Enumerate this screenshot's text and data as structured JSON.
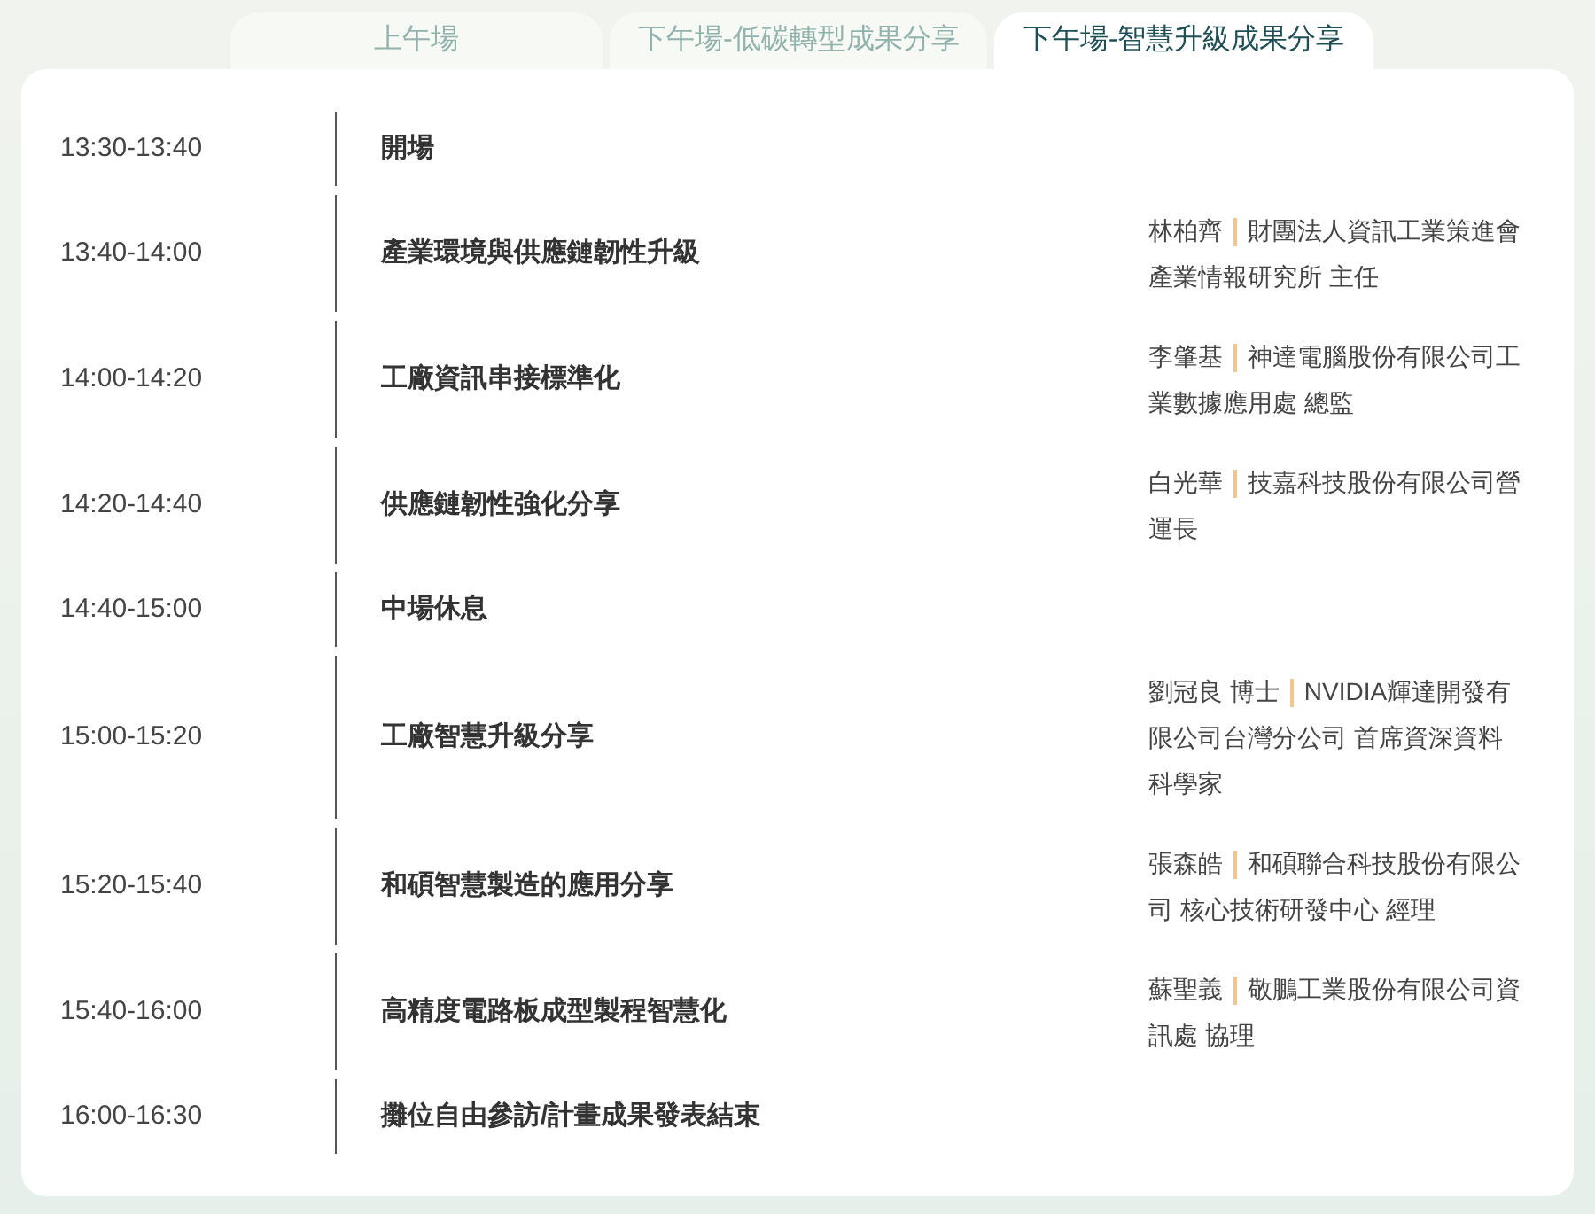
{
  "tabs": [
    {
      "label": "上午場",
      "selected": false
    },
    {
      "label": "下午場-低碳轉型成果分享",
      "selected": false
    },
    {
      "label": "下午場-智慧升級成果分享",
      "selected": true
    }
  ],
  "schedule": [
    {
      "time": "13:30-13:40",
      "title": "開場"
    },
    {
      "time": "13:40-14:00",
      "title": "產業環境與供應鏈韌性升級",
      "speaker": {
        "name": "林柏齊",
        "org": "財團法人資訊工業策進會產業情報研究所 主任"
      }
    },
    {
      "time": "14:00-14:20",
      "title": "工廠資訊串接標準化",
      "speaker": {
        "name": "李肇基",
        "org": "神達電腦股份有限公司工業數據應用處 總監"
      }
    },
    {
      "time": "14:20-14:40",
      "title": "供應鏈韌性強化分享",
      "speaker": {
        "name": "白光華",
        "org": "技嘉科技股份有限公司營運長"
      }
    },
    {
      "time": "14:40-15:00",
      "title": "中場休息"
    },
    {
      "time": "15:00-15:20",
      "title": "工廠智慧升級分享",
      "speaker": {
        "name": "劉冠良 博士",
        "org": "NVIDIA輝達開發有限公司台灣分公司 首席資深資料科學家"
      }
    },
    {
      "time": "15:20-15:40",
      "title": "和碩智慧製造的應用分享",
      "speaker": {
        "name": "張森皓",
        "org": "和碩聯合科技股份有限公司 核心技術研發中心 經理"
      }
    },
    {
      "time": "15:40-16:00",
      "title": "高精度電路板成型製程智慧化",
      "speaker": {
        "name": "蘇聖義",
        "org": "敬鵬工業股份有限公司資訊處 協理"
      }
    },
    {
      "time": "16:00-16:30",
      "title": "攤位自由參訪/計畫成果發表結束"
    }
  ]
}
